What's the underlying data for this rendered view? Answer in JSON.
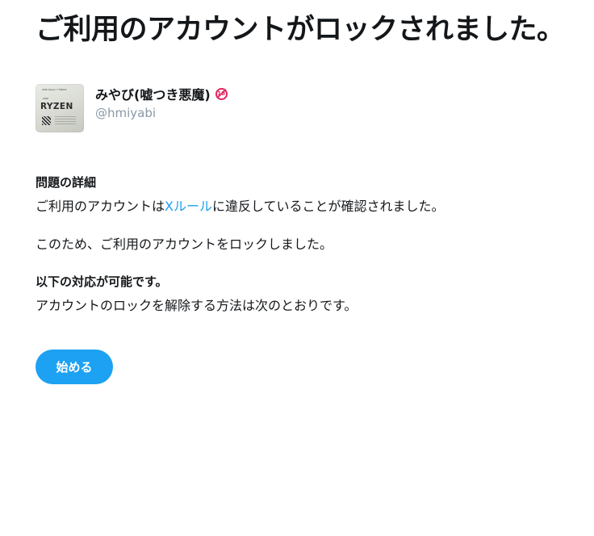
{
  "page": {
    "title": "ご利用のアカウントがロックされました。"
  },
  "user": {
    "display_name": "みやび(嘘つき悪魔)",
    "handle": "@hmiyabi",
    "avatar_text": {
      "top": "AMD Ryzen 7 5800X",
      "small": "AMD",
      "brand": "RYZEN"
    },
    "badge": "18"
  },
  "details": {
    "heading": "問題の詳細",
    "line1_prefix": "ご利用のアカウントは",
    "line1_link": "Xルール",
    "line1_suffix": "に違反していることが確認されました。",
    "line2": "このため、ご利用のアカウントをロックしました。"
  },
  "options": {
    "heading": "以下の対応が可能です。",
    "line": "アカウントのロックを解除する方法は次のとおりです。"
  },
  "actions": {
    "start_label": "始める"
  },
  "colors": {
    "accent": "#1da1f2",
    "text": "#14171a",
    "muted": "#8899a6",
    "badge": "#e0245e"
  }
}
